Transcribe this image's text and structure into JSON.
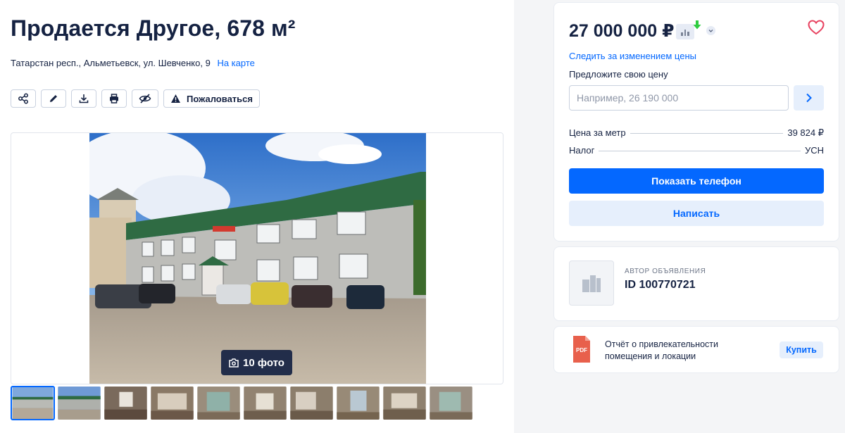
{
  "listing": {
    "title": "Продается Другое, 678 м²",
    "address": "Татарстан респ., Альметьевск, ул. Шевченко, 9",
    "map_link": "На карте"
  },
  "toolbar": {
    "complain_label": "Пожаловаться"
  },
  "gallery": {
    "photo_count_label": "10 фото",
    "thumbnails_count": 10,
    "active_thumbnail": 1
  },
  "price_card": {
    "price": "27 000 000 ₽",
    "follow_price": "Следить за изменением цены",
    "offer_label": "Предложите свою цену",
    "offer_placeholder": "Например, 26 190 000",
    "price_per_meter_label": "Цена за метр",
    "price_per_meter_value": "39 824 ₽",
    "tax_label": "Налог",
    "tax_value": "УСН",
    "show_phone": "Показать телефон",
    "write": "Написать"
  },
  "author": {
    "label": "АВТОР ОБЪЯВЛЕНИЯ",
    "id": "ID 100770721"
  },
  "report": {
    "pdf_badge": "PDF",
    "text": "Отчёт о привлекательности помещения и локации",
    "buy": "Купить"
  },
  "colors": {
    "accent": "#0468ff",
    "text": "#152242",
    "heart": "#e84260",
    "secondary_button": "#e6effc",
    "price_trend": "#2ecc40"
  }
}
